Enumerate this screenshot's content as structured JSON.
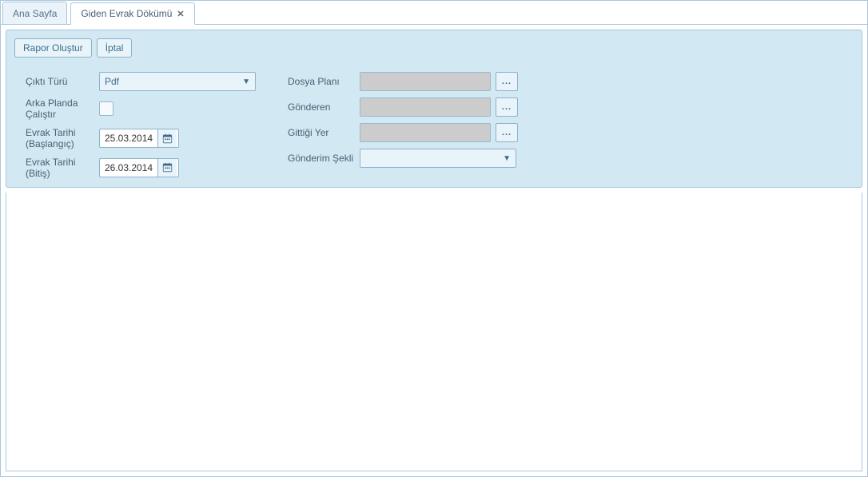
{
  "tabs": {
    "home": "Ana Sayfa",
    "active": "Giden Evrak Dökümü"
  },
  "toolbar": {
    "create_report": "Rapor Oluştur",
    "cancel": "İptal"
  },
  "form": {
    "output_type_label": "Çıktı Türü",
    "output_type_value": "Pdf",
    "bg_run_label": "Arka Planda Çalıştır",
    "date_start_label": "Evrak Tarihi (Başlangıç)",
    "date_start_value": "25.03.2014",
    "date_end_label": "Evrak Tarihi (Bitiş)",
    "date_end_value": "26.03.2014",
    "file_plan_label": "Dosya Planı",
    "sender_label": "Gönderen",
    "destination_label": "Gittiği Yer",
    "send_method_label": "Gönderim Şekli",
    "lookup_btn": "..."
  }
}
